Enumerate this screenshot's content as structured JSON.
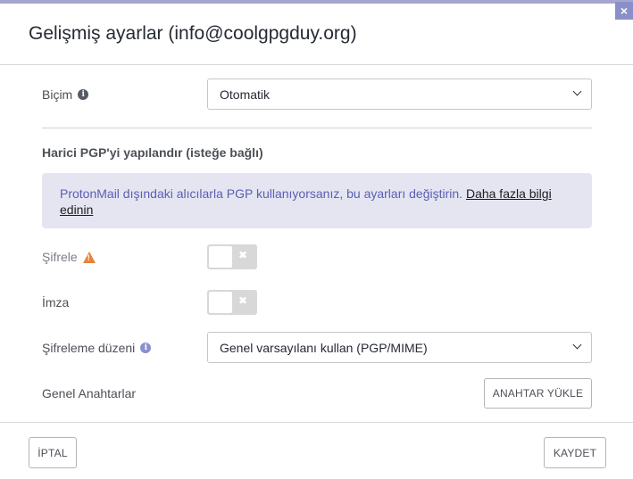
{
  "dialog": {
    "title": "Gelişmiş ayarlar (info@coolgpgduy.org)",
    "close_glyph": "×"
  },
  "format": {
    "label": "Biçim",
    "value": "Otomatik"
  },
  "external_pgp": {
    "section_title": "Harici PGP'yi yapılandır (isteğe bağlı)",
    "alert_text": "ProtonMail dışındaki alıcılarla PGP kullanıyorsanız, bu ayarları değiştirin.",
    "alert_link": "Daha fazla bilgi edinin"
  },
  "encrypt": {
    "label": "Şifrele",
    "enabled": false
  },
  "sign": {
    "label": "İmza",
    "enabled": false
  },
  "scheme": {
    "label": "Şifreleme düzeni",
    "value": "Genel varsayılanı kullan (PGP/MIME)"
  },
  "public_keys": {
    "label": "Genel Anahtarlar",
    "upload_button": "ANAHTAR YÜKLE"
  },
  "footer": {
    "cancel_button": "İPTAL",
    "save_button": "KAYDET"
  },
  "colors": {
    "accent": "#8a8fd0",
    "alert_bg": "#e4e5f1",
    "alert_text": "#5a5fb2",
    "warning": "#e8823a"
  }
}
